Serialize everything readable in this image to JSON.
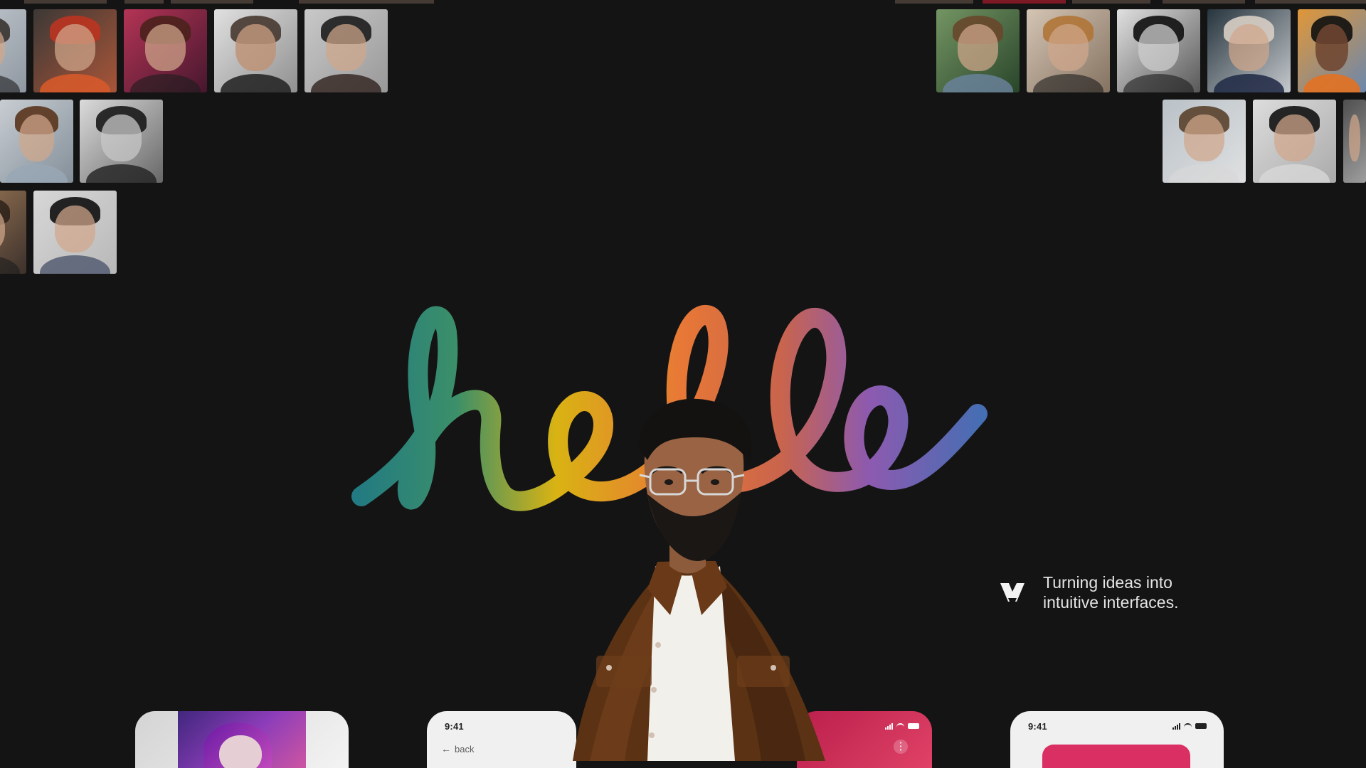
{
  "hero": {
    "word": "hello",
    "tagline": "Turning ideas into\nintuitive interfaces.",
    "colors": {
      "teal": "#227a82",
      "yellow": "#d9b313",
      "orange": "#e87836",
      "purple": "#8d5ab0",
      "blue": "#456eb3",
      "background": "#141414"
    }
  },
  "phone_cards": {
    "time": "9:41",
    "back_label": "back"
  },
  "icons": {
    "logo": "logo-mark-icon",
    "back": "back-arrow-icon",
    "signal": "signal-icon",
    "wifi": "wifi-icon",
    "battery": "battery-icon",
    "menu": "more-vertical-icon"
  }
}
